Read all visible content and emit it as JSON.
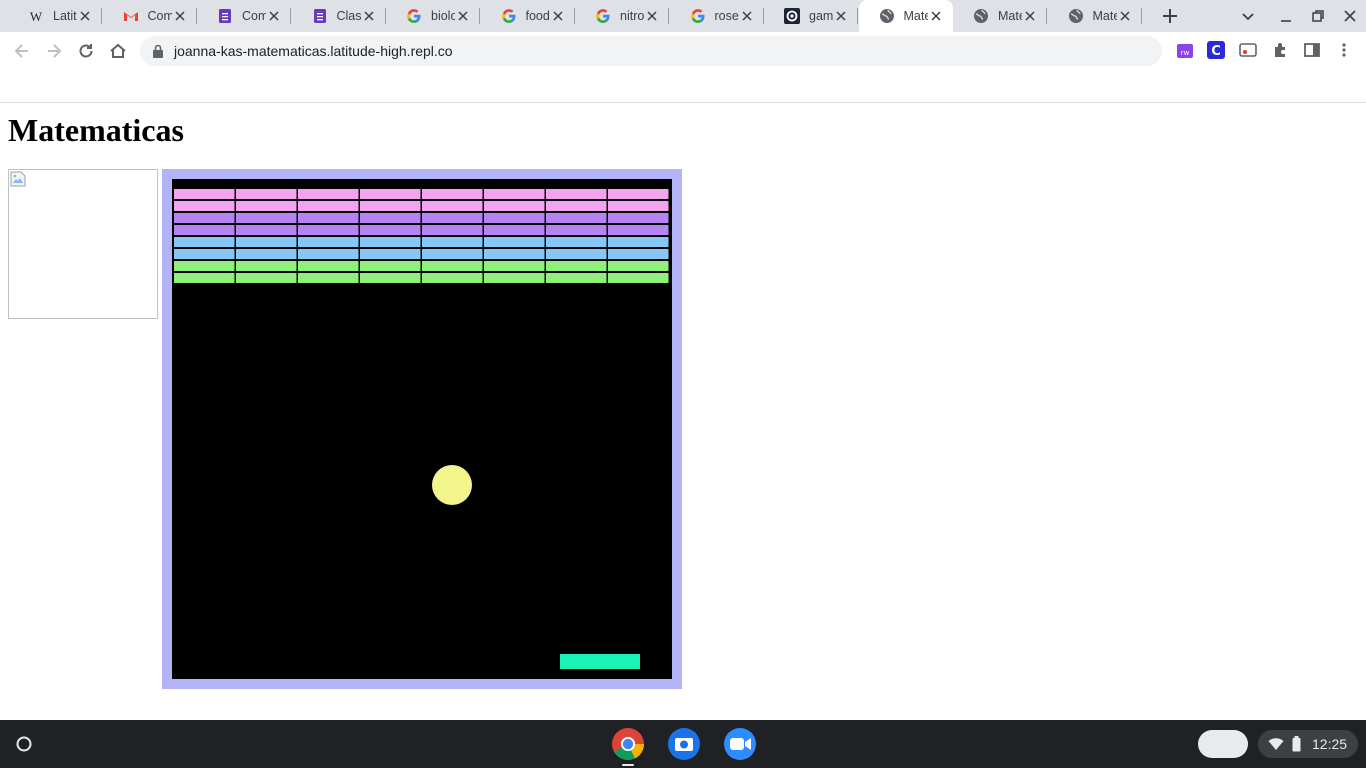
{
  "browser": {
    "tabs": [
      {
        "title": "Latitu",
        "icon": "wikipedia-icon"
      },
      {
        "title": "Comp",
        "icon": "gmail-icon"
      },
      {
        "title": "Comp",
        "icon": "forms-icon"
      },
      {
        "title": "Class",
        "icon": "forms-icon"
      },
      {
        "title": "biolo",
        "icon": "google-icon"
      },
      {
        "title": "food",
        "icon": "google-icon"
      },
      {
        "title": "nitrog",
        "icon": "google-icon"
      },
      {
        "title": "rosett",
        "icon": "google-icon"
      },
      {
        "title": "game",
        "icon": "replit-icon"
      },
      {
        "title": "Mate",
        "icon": "globe-icon",
        "active": true
      },
      {
        "title": "Mate",
        "icon": "globe-icon"
      },
      {
        "title": "Mate",
        "icon": "globe-icon"
      }
    ],
    "url": "joanna-kas-matematicas.latitude-high.repl.co"
  },
  "page": {
    "heading": "Matematicas"
  },
  "game": {
    "brick_columns": 8,
    "brick_rows": [
      {
        "color": "#f5a3f0"
      },
      {
        "color": "#f5a3f0"
      },
      {
        "color": "#b583f2"
      },
      {
        "color": "#b583f2"
      },
      {
        "color": "#87c7f5"
      },
      {
        "color": "#87c7f5"
      },
      {
        "color": "#8ff07b"
      },
      {
        "color": "#8ff07b"
      }
    ],
    "ball_color": "#f2f58a",
    "paddle_color": "#1cf2b8",
    "board_color": "#000000",
    "frame_color": "#b3b3f7"
  },
  "shelf": {
    "apps": [
      "chrome-icon",
      "camera-icon",
      "zoom-icon"
    ],
    "clock": "12:25"
  }
}
